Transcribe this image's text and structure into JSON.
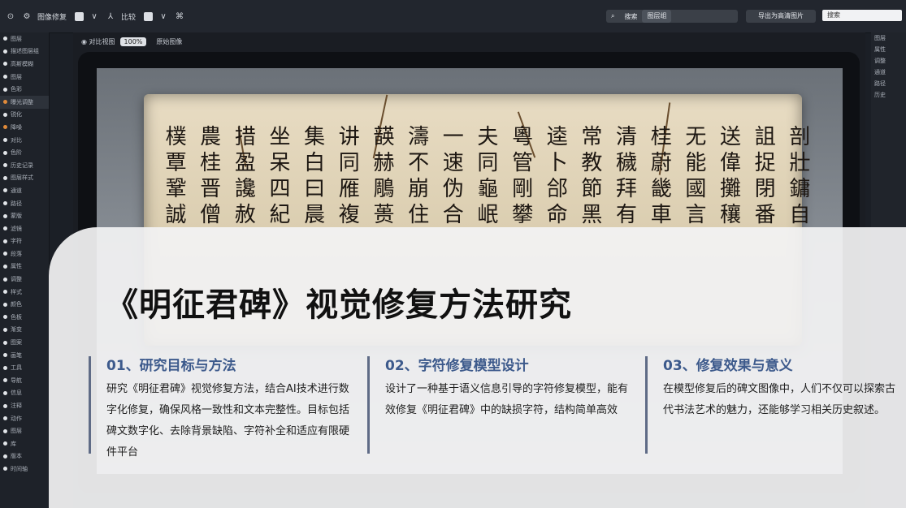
{
  "toolbar": {
    "app_label": "图像修复",
    "tools": [
      "cursor-icon",
      "chevron-down-icon",
      "align-icon",
      "stop-icon",
      "chevron-down-icon",
      "paint-icon"
    ],
    "tool_label": "比较",
    "search_left": "搜索",
    "search_right": "图层组",
    "pill": "导出为高清图片",
    "input_value": "搜索"
  },
  "tree": [
    "显示设置",
    "图像与文字图层组",
    "入选图层",
    "目标图层"
  ],
  "sidebar_items": [
    {
      "label": "图层",
      "dot": "w"
    },
    {
      "label": "描述图层组",
      "dot": "w"
    },
    {
      "label": "高斯模糊",
      "dot": "w"
    },
    {
      "label": "图层",
      "dot": "w"
    },
    {
      "label": "色彩",
      "dot": "w"
    },
    {
      "label": "曝光调整",
      "dot": "o"
    },
    {
      "label": "锐化",
      "dot": "w"
    },
    {
      "label": "降噪",
      "dot": "o"
    },
    {
      "label": "对比",
      "dot": "w"
    },
    {
      "label": "色阶",
      "dot": "w"
    },
    {
      "label": "历史记录",
      "dot": "w"
    },
    {
      "label": "图层样式",
      "dot": "w"
    },
    {
      "label": "通道",
      "dot": "w"
    },
    {
      "label": "路径",
      "dot": "w"
    },
    {
      "label": "蒙版",
      "dot": "w"
    },
    {
      "label": "滤镜",
      "dot": "w"
    },
    {
      "label": "字符",
      "dot": "w"
    },
    {
      "label": "段落",
      "dot": "w"
    },
    {
      "label": "属性",
      "dot": "w"
    },
    {
      "label": "调整",
      "dot": "w"
    },
    {
      "label": "样式",
      "dot": "w"
    },
    {
      "label": "颜色",
      "dot": "w"
    },
    {
      "label": "色板",
      "dot": "w"
    },
    {
      "label": "渐变",
      "dot": "w"
    },
    {
      "label": "图案",
      "dot": "w"
    },
    {
      "label": "画笔",
      "dot": "w"
    },
    {
      "label": "工具",
      "dot": "w"
    },
    {
      "label": "导航",
      "dot": "w"
    },
    {
      "label": "信息",
      "dot": "w"
    },
    {
      "label": "注释",
      "dot": "w"
    },
    {
      "label": "动作",
      "dot": "w"
    },
    {
      "label": "图层",
      "dot": "w"
    },
    {
      "label": "库",
      "dot": "w"
    },
    {
      "label": "版本",
      "dot": "w"
    },
    {
      "label": "时间轴",
      "dot": "w"
    }
  ],
  "canvas_head": {
    "label": "对比视图",
    "chip": "100%",
    "extra": "原始图像"
  },
  "right_panel": [
    "图层",
    "属性",
    "调整",
    "通道",
    "路径",
    "历史"
  ],
  "scroll_columns": [
    "剖壯鏞自",
    "詛捉閉番",
    "送偉攤穰",
    "无能國言",
    "桂蔚畿車",
    "清穢拜有",
    "常教節黑",
    "逵卜郃命",
    "粵管剛攀",
    "夫同龜岷",
    "一速伪合",
    "濤不崩住",
    "韺赫鵰蒉",
    "讲同雁複",
    "集白曰晨",
    "坐呆四紀",
    "措盈讒赦",
    "農桂晋僧",
    "樸覃鞏誠"
  ],
  "overlay": {
    "title": "《明征君碑》视觉修复方法研究",
    "sections": [
      {
        "heading": "01、研究目标与方法",
        "body": "研究《明征君碑》视觉修复方法，结合AI技术进行数字化修复，确保风格一致性和文本完整性。目标包括碑文数字化、去除背景缺陷、字符补全和适应有限硬件平台"
      },
      {
        "heading": "02、字符修复模型设计",
        "body": "设计了一种基于语义信息引导的字符修复模型，能有效修复《明征君碑》中的缺损字符，结构简单高效"
      },
      {
        "heading": "03、修复效果与意义",
        "body": "在模型修复后的碑文图像中，人们不仅可以探索古代书法艺术的魅力，还能够学习相关历史叙述。"
      }
    ]
  }
}
